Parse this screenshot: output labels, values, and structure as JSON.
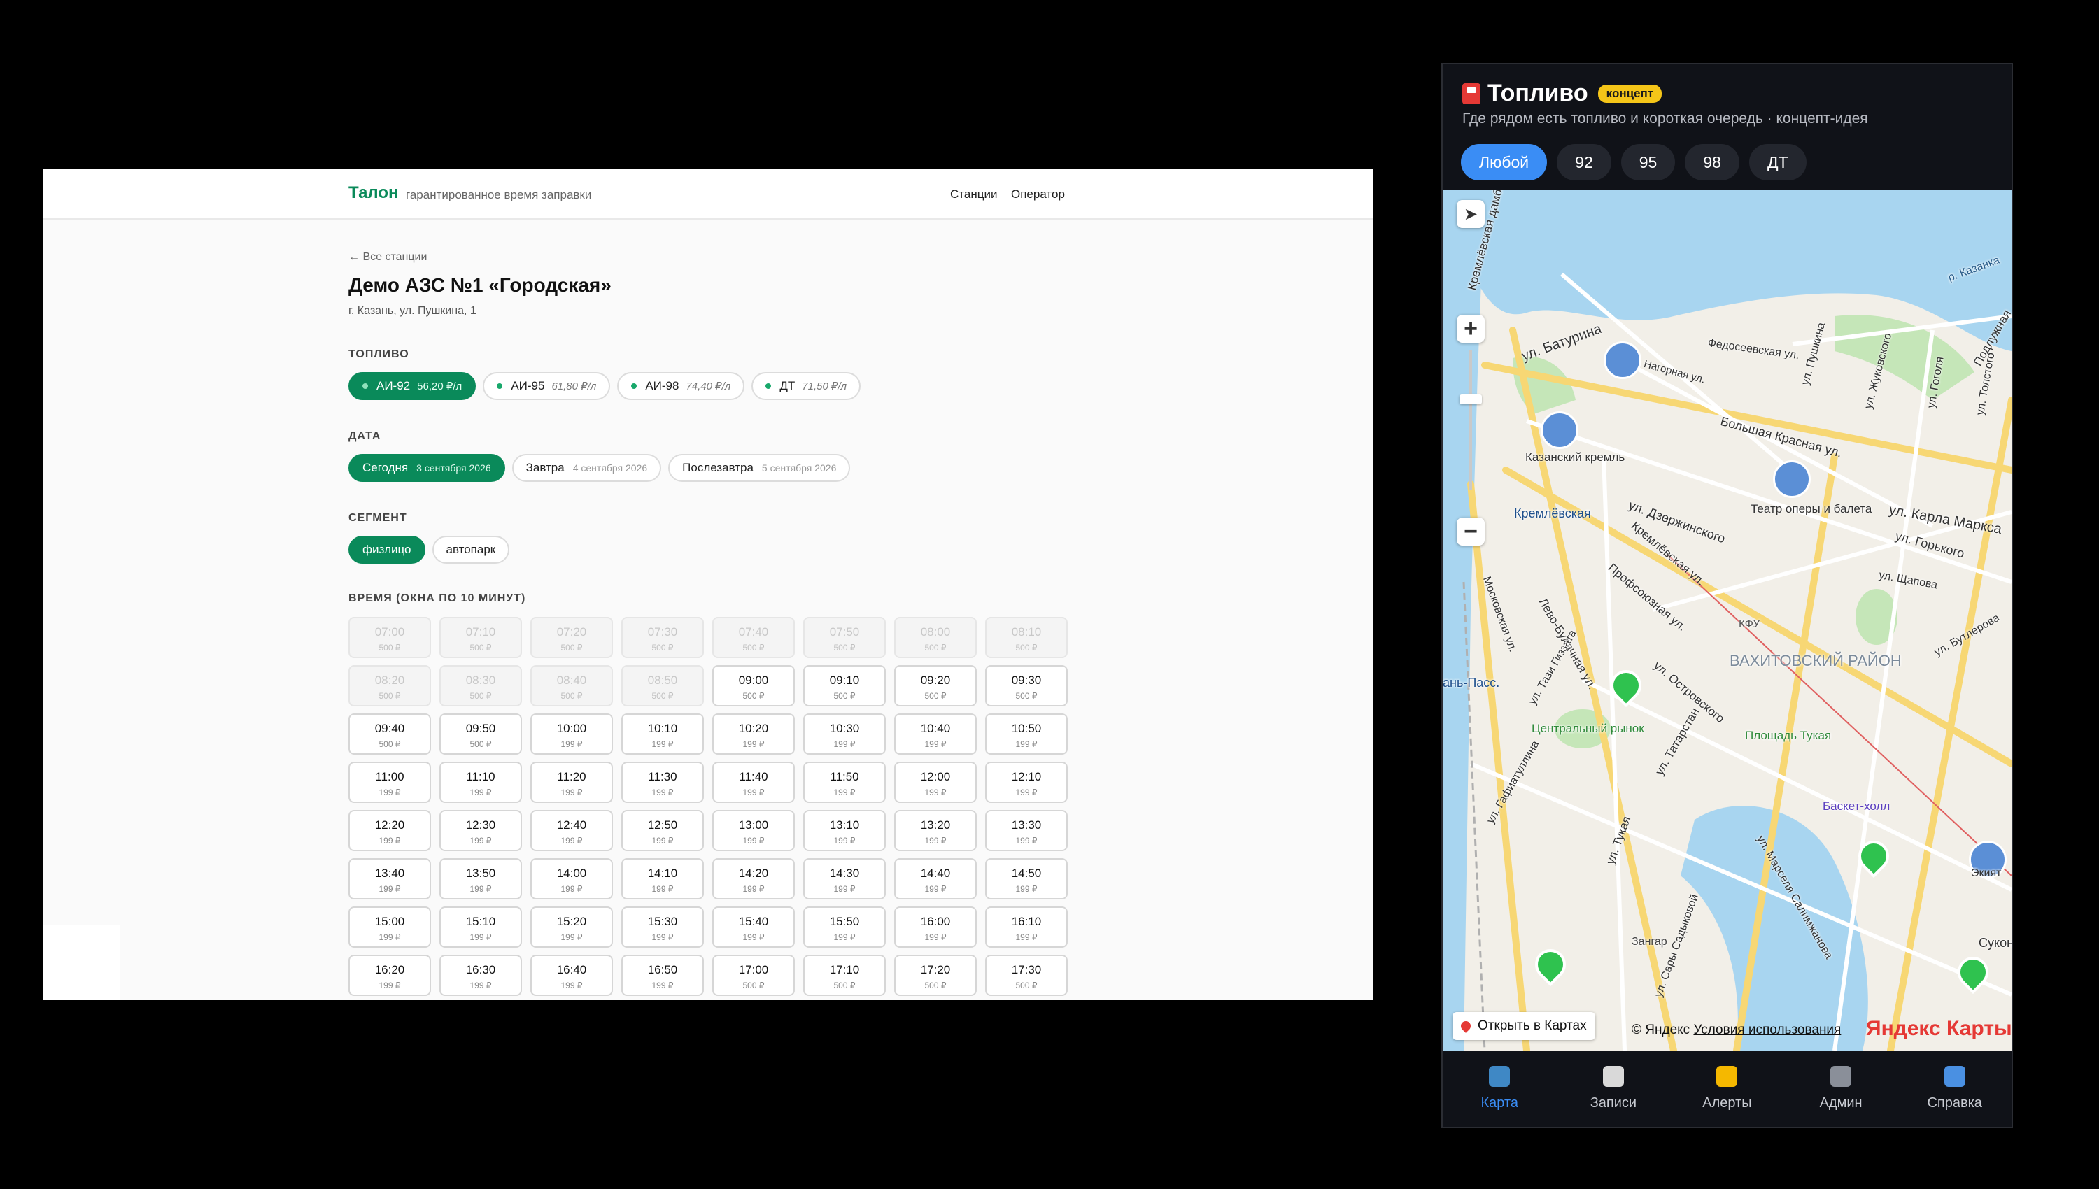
{
  "talon": {
    "brand": "Талон",
    "tagline": "гарантированное время заправки",
    "nav": [
      "Станции",
      "Оператор"
    ],
    "back_link": "← Все станции",
    "station_title": "Демо АЗС №1 «Городская»",
    "station_address": "г. Казань, ул. Пушкина, 1",
    "fuel_label": "ТОПЛИВО",
    "fuels": [
      {
        "name": "АИ-92",
        "price": "56,20 ₽/л",
        "active": true
      },
      {
        "name": "АИ-95",
        "price": "61,80 ₽/л",
        "active": false
      },
      {
        "name": "АИ-98",
        "price": "74,40 ₽/л",
        "active": false
      },
      {
        "name": "ДТ",
        "price": "71,50 ₽/л",
        "active": false
      }
    ],
    "date_label": "ДАТА",
    "dates": [
      {
        "name": "Сегодня",
        "date": "3 сентября 2026",
        "active": true
      },
      {
        "name": "Завтра",
        "date": "4 сентября 2026",
        "active": false
      },
      {
        "name": "Послезавтра",
        "date": "5 сентября 2026",
        "active": false
      }
    ],
    "segment_label": "СЕГМЕНТ",
    "segments": [
      {
        "name": "физлицо",
        "active": true
      },
      {
        "name": "автопарк",
        "active": false
      }
    ],
    "time_label": "ВРЕМЯ (ОКНА ПО 10 МИНУТ)",
    "slots": [
      {
        "time": "07:00",
        "price": "500 ₽",
        "disabled": true
      },
      {
        "time": "07:10",
        "price": "500 ₽",
        "disabled": true
      },
      {
        "time": "07:20",
        "price": "500 ₽",
        "disabled": true
      },
      {
        "time": "07:30",
        "price": "500 ₽",
        "disabled": true
      },
      {
        "time": "07:40",
        "price": "500 ₽",
        "disabled": true
      },
      {
        "time": "07:50",
        "price": "500 ₽",
        "disabled": true
      },
      {
        "time": "08:00",
        "price": "500 ₽",
        "disabled": true
      },
      {
        "time": "08:10",
        "price": "500 ₽",
        "disabled": true
      },
      {
        "time": "08:20",
        "price": "500 ₽",
        "disabled": true
      },
      {
        "time": "08:30",
        "price": "500 ₽",
        "disabled": true
      },
      {
        "time": "08:40",
        "price": "500 ₽",
        "disabled": true
      },
      {
        "time": "08:50",
        "price": "500 ₽",
        "disabled": true
      },
      {
        "time": "09:00",
        "price": "500 ₽",
        "disabled": false
      },
      {
        "time": "09:10",
        "price": "500 ₽",
        "disabled": false
      },
      {
        "time": "09:20",
        "price": "500 ₽",
        "disabled": false
      },
      {
        "time": "09:30",
        "price": "500 ₽",
        "disabled": false
      },
      {
        "time": "09:40",
        "price": "500 ₽",
        "disabled": false
      },
      {
        "time": "09:50",
        "price": "500 ₽",
        "disabled": false
      },
      {
        "time": "10:00",
        "price": "199 ₽",
        "disabled": false
      },
      {
        "time": "10:10",
        "price": "199 ₽",
        "disabled": false
      },
      {
        "time": "10:20",
        "price": "199 ₽",
        "disabled": false
      },
      {
        "time": "10:30",
        "price": "199 ₽",
        "disabled": false
      },
      {
        "time": "10:40",
        "price": "199 ₽",
        "disabled": false
      },
      {
        "time": "10:50",
        "price": "199 ₽",
        "disabled": false
      },
      {
        "time": "11:00",
        "price": "199 ₽",
        "disabled": false
      },
      {
        "time": "11:10",
        "price": "199 ₽",
        "disabled": false
      },
      {
        "time": "11:20",
        "price": "199 ₽",
        "disabled": false
      },
      {
        "time": "11:30",
        "price": "199 ₽",
        "disabled": false
      },
      {
        "time": "11:40",
        "price": "199 ₽",
        "disabled": false
      },
      {
        "time": "11:50",
        "price": "199 ₽",
        "disabled": false
      },
      {
        "time": "12:00",
        "price": "199 ₽",
        "disabled": false
      },
      {
        "time": "12:10",
        "price": "199 ₽",
        "disabled": false
      },
      {
        "time": "12:20",
        "price": "199 ₽",
        "disabled": false
      },
      {
        "time": "12:30",
        "price": "199 ₽",
        "disabled": false
      },
      {
        "time": "12:40",
        "price": "199 ₽",
        "disabled": false
      },
      {
        "time": "12:50",
        "price": "199 ₽",
        "disabled": false
      },
      {
        "time": "13:00",
        "price": "199 ₽",
        "disabled": false
      },
      {
        "time": "13:10",
        "price": "199 ₽",
        "disabled": false
      },
      {
        "time": "13:20",
        "price": "199 ₽",
        "disabled": false
      },
      {
        "time": "13:30",
        "price": "199 ₽",
        "disabled": false
      },
      {
        "time": "13:40",
        "price": "199 ₽",
        "disabled": false
      },
      {
        "time": "13:50",
        "price": "199 ₽",
        "disabled": false
      },
      {
        "time": "14:00",
        "price": "199 ₽",
        "disabled": false
      },
      {
        "time": "14:10",
        "price": "199 ₽",
        "disabled": false
      },
      {
        "time": "14:20",
        "price": "199 ₽",
        "disabled": false
      },
      {
        "time": "14:30",
        "price": "199 ₽",
        "disabled": false
      },
      {
        "time": "14:40",
        "price": "199 ₽",
        "disabled": false
      },
      {
        "time": "14:50",
        "price": "199 ₽",
        "disabled": false
      },
      {
        "time": "15:00",
        "price": "199 ₽",
        "disabled": false
      },
      {
        "time": "15:10",
        "price": "199 ₽",
        "disabled": false
      },
      {
        "time": "15:20",
        "price": "199 ₽",
        "disabled": false
      },
      {
        "time": "15:30",
        "price": "199 ₽",
        "disabled": false
      },
      {
        "time": "15:40",
        "price": "199 ₽",
        "disabled": false
      },
      {
        "time": "15:50",
        "price": "199 ₽",
        "disabled": false
      },
      {
        "time": "16:00",
        "price": "199 ₽",
        "disabled": false
      },
      {
        "time": "16:10",
        "price": "199 ₽",
        "disabled": false
      },
      {
        "time": "16:20",
        "price": "199 ₽",
        "disabled": false
      },
      {
        "time": "16:30",
        "price": "199 ₽",
        "disabled": false
      },
      {
        "time": "16:40",
        "price": "199 ₽",
        "disabled": false
      },
      {
        "time": "16:50",
        "price": "199 ₽",
        "disabled": false
      },
      {
        "time": "17:00",
        "price": "500 ₽",
        "disabled": false
      },
      {
        "time": "17:10",
        "price": "500 ₽",
        "disabled": false
      },
      {
        "time": "17:20",
        "price": "500 ₽",
        "disabled": false
      },
      {
        "time": "17:30",
        "price": "500 ₽",
        "disabled": false
      }
    ],
    "colors": {
      "accent": "#0a8a5a"
    }
  },
  "fuel_app": {
    "title": "Топливо",
    "badge": "концепт",
    "subtitle": "Где рядом есть топливо и короткая очередь · концепт-идея",
    "filters": [
      {
        "label": "Любой",
        "active": true
      },
      {
        "label": "92",
        "active": false
      },
      {
        "label": "95",
        "active": false
      },
      {
        "label": "98",
        "active": false
      },
      {
        "label": "ДТ",
        "active": false
      }
    ],
    "map": {
      "labels": [
        {
          "text": "р. Казанка"
        },
        {
          "text": "Кремлёвская дамба"
        },
        {
          "text": "ул. Батурина"
        },
        {
          "text": "Федосеевская ул."
        },
        {
          "text": "Нагорная ул."
        },
        {
          "text": "Подлужная"
        },
        {
          "text": "Казанский кремль"
        },
        {
          "text": "Большая Красная ул."
        },
        {
          "text": "ул. Пушкина"
        },
        {
          "text": "ул. Жуковского"
        },
        {
          "text": "ул. Гоголя"
        },
        {
          "text": "ул. Толстого"
        },
        {
          "text": "ул. Дзержинского"
        },
        {
          "text": "Театр оперы и балета"
        },
        {
          "text": "ул. Карла Маркса"
        },
        {
          "text": "Кремлёвская"
        },
        {
          "text": "Кремлёвская ул."
        },
        {
          "text": "ул. Горького"
        },
        {
          "text": "Профсоюзная ул."
        },
        {
          "text": "Московская ул."
        },
        {
          "text": "Лево-Булачная ул."
        },
        {
          "text": "ул. Щапова"
        },
        {
          "text": "КФУ"
        },
        {
          "text": "ул. Бутлерова"
        },
        {
          "text": "ВАХИТОВСКИЙ РАЙОН"
        },
        {
          "text": "ул. Островского"
        },
        {
          "text": "ань-Пасс."
        },
        {
          "text": "ул. Тази Гиззата"
        },
        {
          "text": "Центральный рынок"
        },
        {
          "text": "Площадь Тукая"
        },
        {
          "text": "ул. Татарстан"
        },
        {
          "text": "Баскет-холл"
        },
        {
          "text": "ул. Гафиатуллина"
        },
        {
          "text": "ул. Марселя Салимжанова"
        },
        {
          "text": "Экият"
        },
        {
          "text": "Зангар"
        },
        {
          "text": "Сукон"
        },
        {
          "text": "ул. Тукая"
        },
        {
          "text": "ул. Сары Садыковой"
        }
      ],
      "open_button": "Открыть в Картах",
      "copyright": "© Яндекс",
      "terms": "Условия использования",
      "logo": "Яндекс Карты"
    },
    "tabs": [
      {
        "label": "Карта",
        "active": true,
        "icon": "map-icon",
        "color": "#3f88c5"
      },
      {
        "label": "Записи",
        "active": false,
        "icon": "receipt-icon",
        "color": "#d9d9d9"
      },
      {
        "label": "Алерты",
        "active": false,
        "icon": "bell-icon",
        "color": "#f5b800"
      },
      {
        "label": "Админ",
        "active": false,
        "icon": "admin-icon",
        "color": "#8a8f99"
      },
      {
        "label": "Справка",
        "active": false,
        "icon": "info-icon",
        "color": "#4a90e2"
      }
    ],
    "colors": {
      "accent": "#3a8df5",
      "badge": "#f5c518"
    }
  }
}
